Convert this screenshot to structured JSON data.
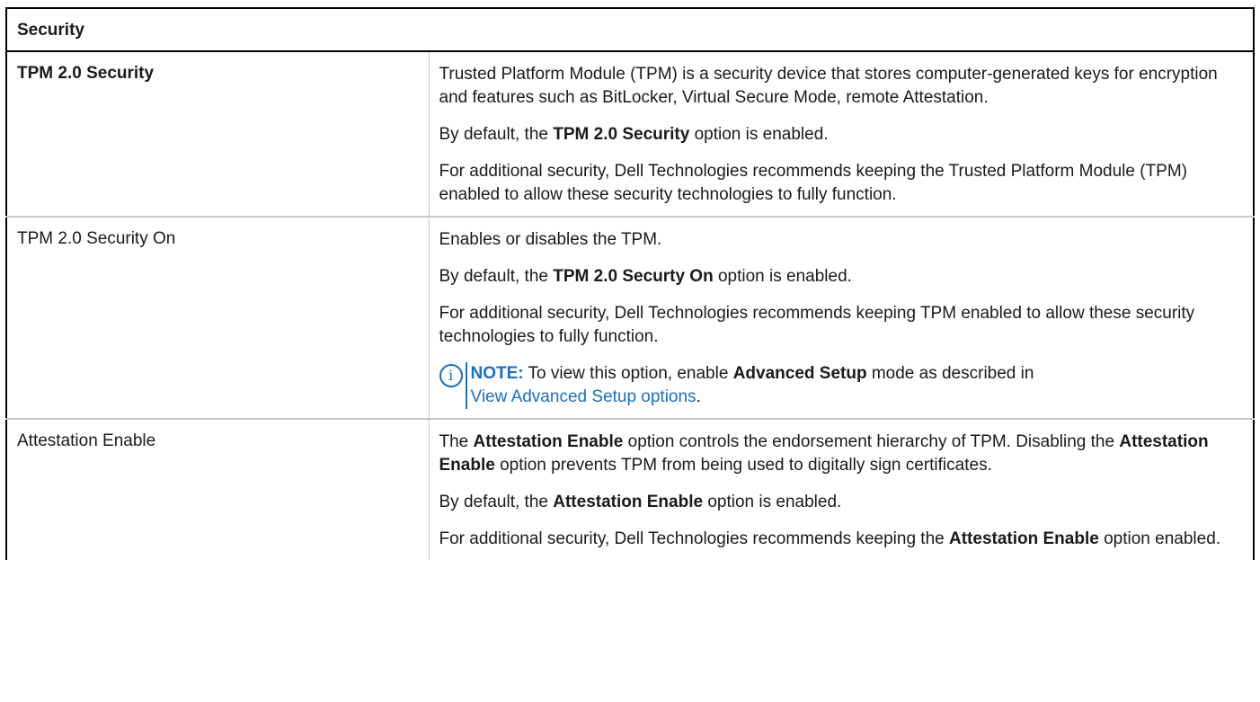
{
  "table": {
    "header": "Security",
    "rows": [
      {
        "name": "TPM 2.0 Security",
        "p1": "Trusted Platform Module (TPM) is a security device that stores computer-generated keys for encryption and features such as BitLocker, Virtual Secure Mode, remote Attestation.",
        "p2_pre": "By default, the ",
        "p2_bold": "TPM 2.0 Security",
        "p2_post": " option is enabled.",
        "p3": "For additional security, Dell Technologies recommends keeping the Trusted Platform Module (TPM) enabled to allow these security technologies to fully function."
      },
      {
        "name": "TPM 2.0 Security On",
        "p1": "Enables or disables the TPM.",
        "p2_pre": "By default, the ",
        "p2_bold": "TPM 2.0 Securty On",
        "p2_post": " option is enabled.",
        "p3": "For additional security, Dell Technologies recommends keeping TPM enabled to allow these security technologies to fully function.",
        "note": {
          "icon": "info-icon",
          "label": "NOTE:",
          "text_pre": " To view this option, enable ",
          "text_bold": "Advanced Setup",
          "text_mid": " mode as described in ",
          "link": "View Advanced Setup options",
          "text_post": "."
        }
      },
      {
        "name": "Attestation Enable",
        "p1_pre": "The ",
        "p1_bold1": "Attestation Enable",
        "p1_mid": " option controls the endorsement hierarchy of TPM. Disabling the ",
        "p1_bold2": "Attestation Enable",
        "p1_post": " option prevents TPM from being used to digitally sign certificates.",
        "p2_pre": "By default, the ",
        "p2_bold": "Attestation Enable",
        "p2_post": " option is enabled.",
        "p3_pre": "For additional security, Dell Technologies recommends keeping the ",
        "p3_bold": "Attestation Enable",
        "p3_post": " option enabled."
      }
    ]
  },
  "colors": {
    "accent": "#1c6fbf",
    "border": "#000000",
    "row_divider": "#c8c8c8"
  }
}
